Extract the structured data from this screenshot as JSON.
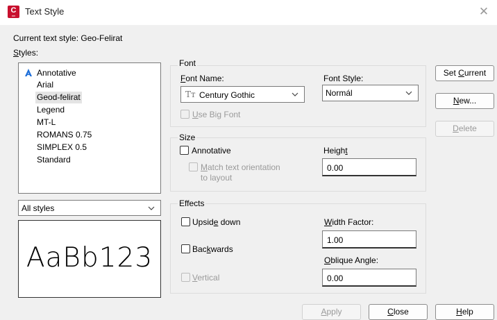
{
  "window": {
    "title": "Text Style",
    "icon_letter": "C",
    "icon_sub": "CIV",
    "close_glyph": "✕"
  },
  "current_style": {
    "label": "Current text style:  Geo-Felirat"
  },
  "styles": {
    "label_key": "S",
    "label_rest": "tyles:",
    "items": [
      {
        "label": "Annotative"
      },
      {
        "label": "Arial"
      },
      {
        "label": "Geod-felirat"
      },
      {
        "label": "Legend"
      },
      {
        "label": "MT-L"
      },
      {
        "label": "ROMANS 0.75"
      },
      {
        "label": "SIMPLEX 0.5"
      },
      {
        "label": "Standard"
      }
    ],
    "selected_index": 2
  },
  "filter": {
    "value": "All styles"
  },
  "preview": {
    "text": "AaBb123"
  },
  "font": {
    "group_title": "Font",
    "name_label_key": "F",
    "name_label_rest": "ont Name:",
    "name_value": "Century Gothic",
    "name_icon_glyph": "Tᴛ",
    "style_label": "Font Style:",
    "style_value": "Normál",
    "big_font_key": "U",
    "big_font_rest": "se Big Font"
  },
  "size": {
    "group_title": "Size",
    "annotative_label": "Annotative",
    "match_key": "M",
    "match_line1_rest": "atch text orientation",
    "match_line2": "to layout",
    "height_label_pre": "Heigh",
    "height_label_key": "t",
    "height_value": "0.00"
  },
  "effects": {
    "group_title": "Effects",
    "upside_pre": "Upsid",
    "upside_key": "e",
    "upside_post": " down",
    "backwards_pre": "Bac",
    "backwards_key": "k",
    "backwards_post": "wards",
    "vertical_key": "V",
    "vertical_rest": "ertical",
    "width_key": "W",
    "width_rest": "idth Factor:",
    "width_value": "1.00",
    "oblique_key": "O",
    "oblique_rest": "blique Angle:",
    "oblique_value": "0.00"
  },
  "buttons": {
    "set_current_pre": "Set ",
    "set_current_key": "C",
    "set_current_post": "urrent",
    "new_key": "N",
    "new_rest": "ew...",
    "delete_key": "D",
    "delete_rest": "elete",
    "apply_key": "A",
    "apply_rest": "pply",
    "close_key": "C",
    "close_rest": "lose",
    "help_key": "H",
    "help_rest": "elp"
  },
  "colors": {
    "annotative_icon": "#1e6fd9",
    "app_icon_bg": "#c8102e"
  }
}
